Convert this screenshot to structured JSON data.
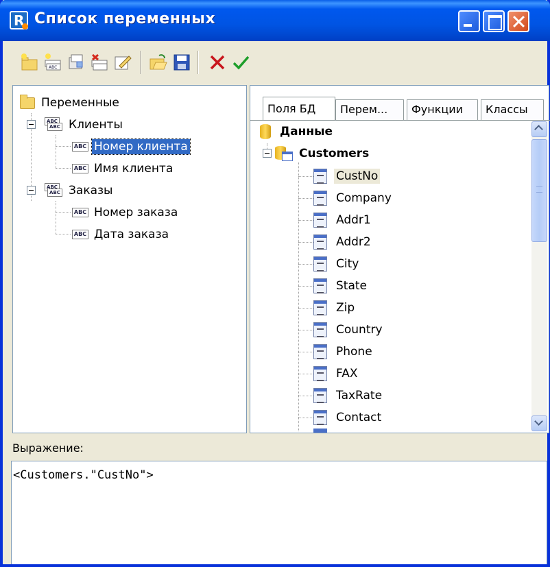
{
  "window": {
    "title": "Список переменных"
  },
  "toolbar": {
    "buttons": [
      "new-category",
      "new-variable",
      "edit",
      "delete",
      "rename",
      "open-file",
      "save-file",
      "cancel",
      "ok"
    ]
  },
  "left_tree": {
    "root": "Переменные",
    "groups": [
      {
        "label": "Клиенты",
        "items": [
          "Номер клиента",
          "Имя клиента"
        ]
      },
      {
        "label": "Заказы",
        "items": [
          "Номер заказа",
          "Дата заказа"
        ]
      }
    ]
  },
  "tabs": [
    {
      "label": "Поля БД",
      "active": true
    },
    {
      "label": "Перем...",
      "active": false
    },
    {
      "label": "Функции",
      "active": false
    },
    {
      "label": "Классы",
      "active": false
    }
  ],
  "db_tree": {
    "root": "Данные",
    "table": "Customers",
    "fields": [
      "CustNo",
      "Company",
      "Addr1",
      "Addr2",
      "City",
      "State",
      "Zip",
      "Country",
      "Phone",
      "FAX",
      "TaxRate",
      "Contact"
    ]
  },
  "expression": {
    "label": "Выражение:",
    "value": "<Customers.\"CustNo\">"
  },
  "colors": {
    "selection": "#316ac5",
    "titlebar": "#0054e3"
  }
}
